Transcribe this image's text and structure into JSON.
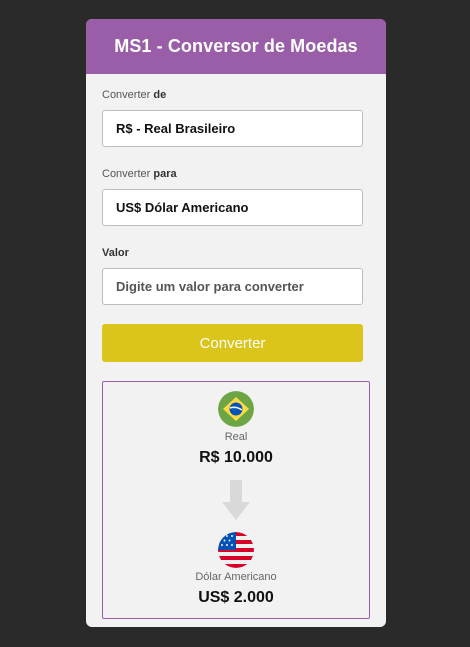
{
  "app": {
    "title": "MS1 - Conversor de Moedas"
  },
  "form": {
    "from_label_prefix": "Converter ",
    "from_label_bold": "de",
    "from_value": "R$ - Real Brasileiro",
    "to_label_prefix": "Converter ",
    "to_label_bold": "para",
    "to_value": "US$ Dólar Americano",
    "amount_label": "Valor",
    "amount_placeholder": "Digite um valor para converter",
    "convert_button": "Converter"
  },
  "result": {
    "from_currency_name": "Real",
    "from_amount": "R$ 10.000",
    "from_flag_icon": "brazil-flag-icon",
    "to_currency_name": "Dólar Americano",
    "to_amount": "US$ 2.000",
    "to_flag_icon": "usa-flag-icon",
    "arrow_icon": "arrow-down-icon"
  },
  "colors": {
    "background": "#2a2a2a",
    "header": "#9a5ea8",
    "button": "#dcc51b",
    "card": "#f2f2f2",
    "result_border": "#9a5ea8"
  }
}
